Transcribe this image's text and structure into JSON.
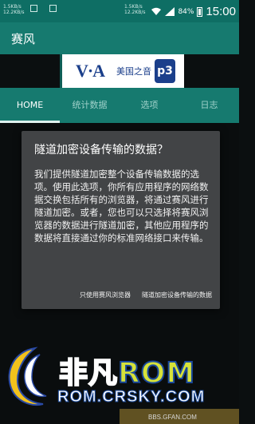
{
  "status_bar": {
    "left_speed": "1.5KB/s",
    "left_speed2": "12.2KB/s",
    "mid_speed": "1.5KB/s",
    "mid_speed2": "12.2KB/s",
    "battery_pct": "84%",
    "time": "15:00",
    "icons": [
      "wifi-icon",
      "signal-icon",
      "battery-icon"
    ]
  },
  "app": {
    "title": "赛风"
  },
  "ad": {
    "logo_text": "V·A",
    "text": "美国之音",
    "badge": "p3"
  },
  "tabs": [
    {
      "label": "HOME",
      "active": true
    },
    {
      "label": "统计数据",
      "active": false
    },
    {
      "label": "选项",
      "active": false
    },
    {
      "label": "日志",
      "active": false
    }
  ],
  "dialog": {
    "title": "隧道加密设备传输的数据？",
    "body": "我们提供隧道加密整个设备传输数据的选项。使用此选项，你所有应用程序的网络数据交换包括所有的浏览器，将通过赛风进行隧道加密。或者，您也可以只选择将赛风浏览器的数据进行隧道加密，其他应用程序的数据将直接通过你的标准网络接口来传输。",
    "buttons": {
      "browser_only": "只使用赛风浏览器",
      "whole_device": "隧道加密设备传输的数据"
    }
  },
  "watermark": {
    "brand_left": "非凡",
    "brand_right": "ROM",
    "site": "ROM.CRSKY.COM",
    "bbs": "BBS.GFAN.COM"
  },
  "colors": {
    "statusbar": "#0e6e64",
    "appbar": "#167a6f",
    "dialog": "#424446"
  }
}
